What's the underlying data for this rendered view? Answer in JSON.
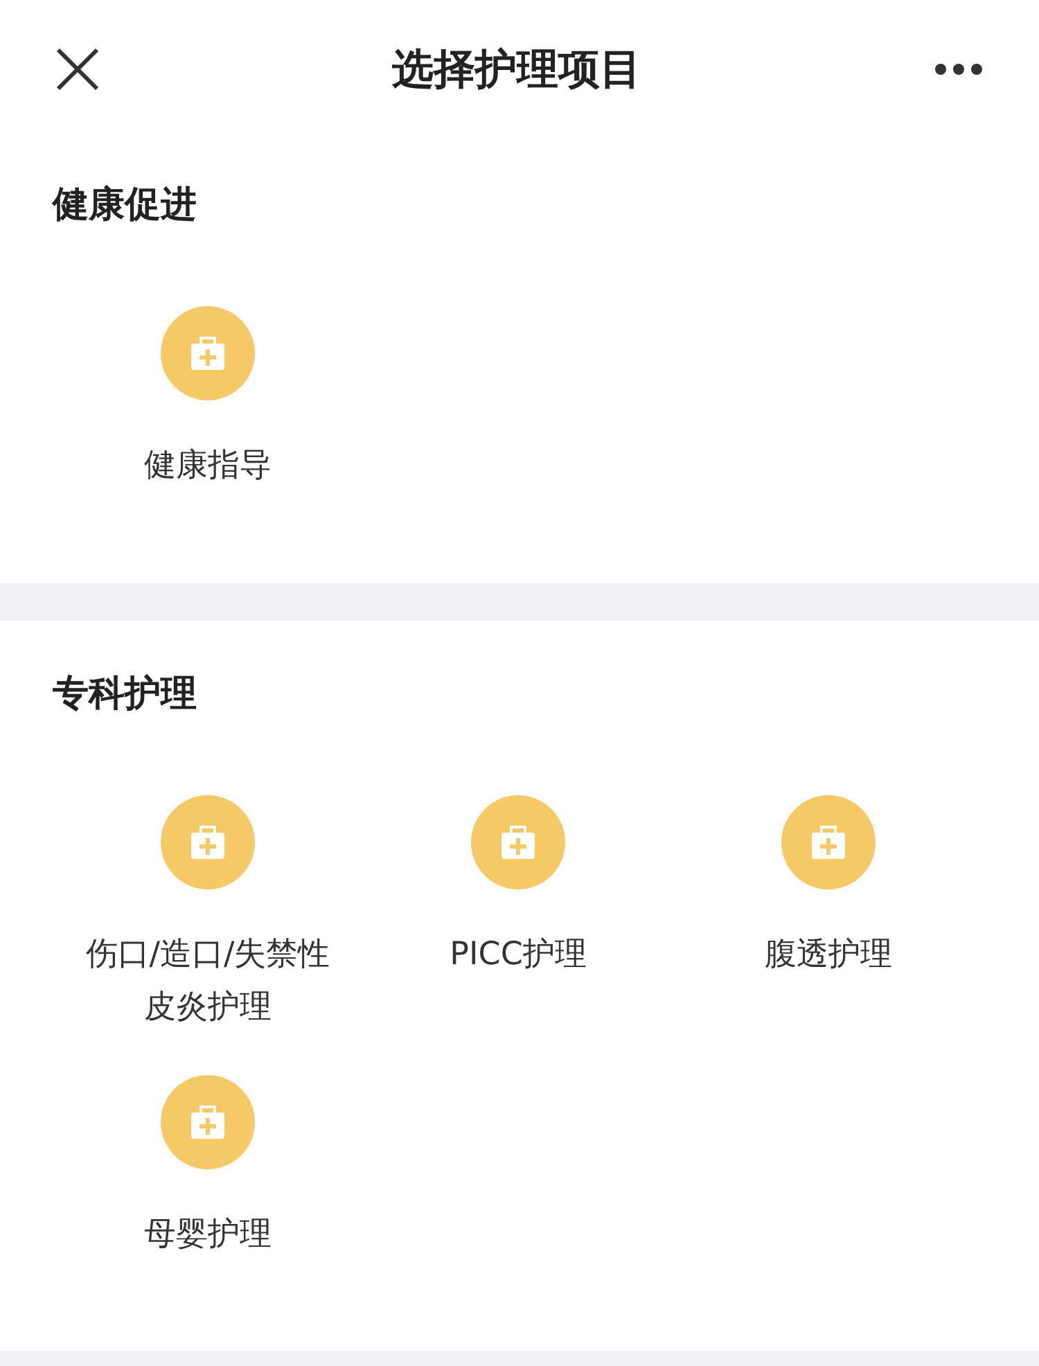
{
  "header": {
    "title": "选择护理项目"
  },
  "sections": [
    {
      "title": "健康促进",
      "items": [
        {
          "label": "健康指导"
        }
      ]
    },
    {
      "title": "专科护理",
      "items": [
        {
          "label": "伤口/造口/失禁性皮炎护理"
        },
        {
          "label": "PICC护理"
        },
        {
          "label": "腹透护理"
        },
        {
          "label": "母婴护理"
        }
      ]
    }
  ]
}
